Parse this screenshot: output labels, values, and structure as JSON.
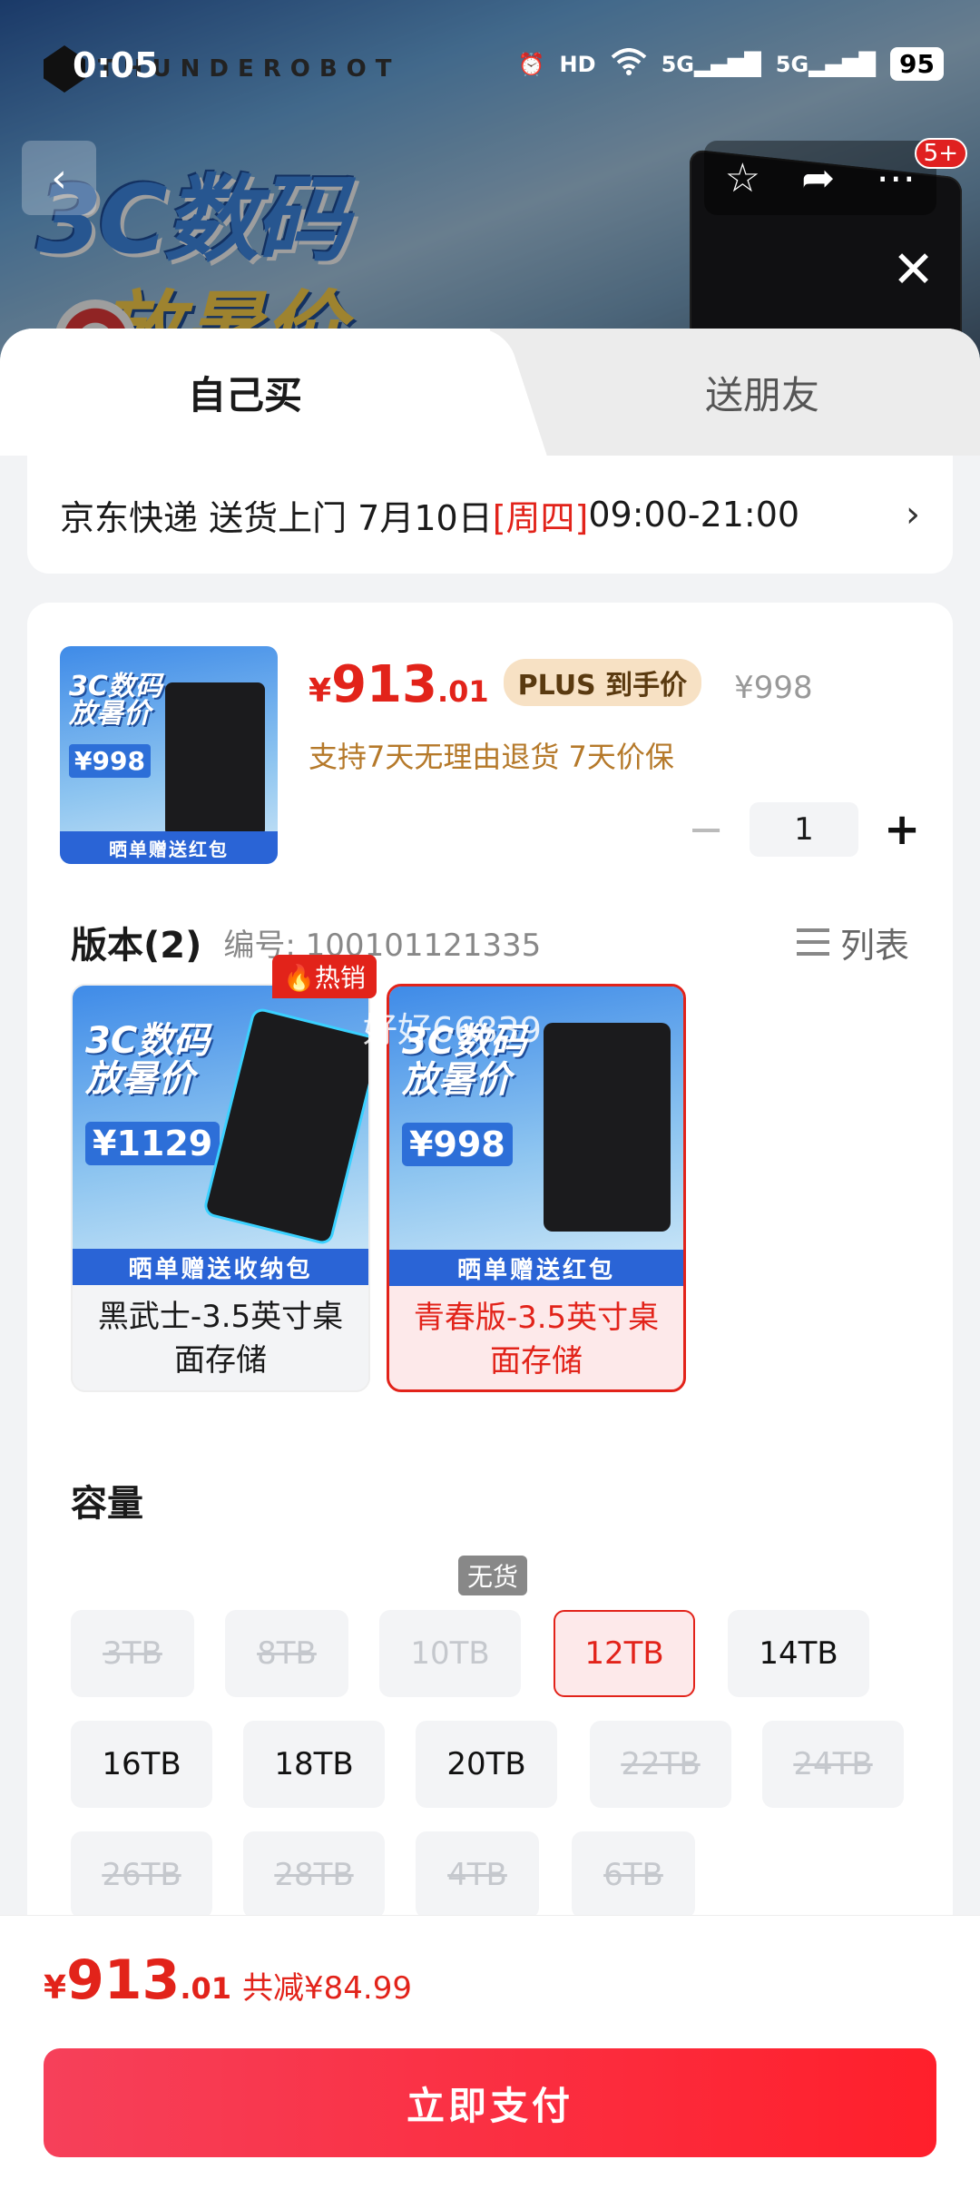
{
  "status_bar": {
    "time": "0:05",
    "brand": "THUNDEROBOT",
    "icons": [
      "alarm-icon",
      "hd-icon",
      "wifi-icon",
      "5g-signal-icon",
      "5g-signal-icon"
    ],
    "hd_label": "HD",
    "net1_label": "5G",
    "net2_label": "5G",
    "battery": "95"
  },
  "banner": {
    "title_line1": "3C数码",
    "title_line2": "放暑价",
    "notification_badge": "5+"
  },
  "tabs": {
    "self": "自己买",
    "friend": "送朋友"
  },
  "delivery": {
    "text": "京东快递 送货上门 7月10日 ",
    "weekday": "[周四]",
    "time": " 09:00-21:00",
    "chevron": "›"
  },
  "product": {
    "thumb_title": "3C数码放暑价",
    "thumb_price": "¥998",
    "thumb_banner": "晒单赠送红包",
    "price_currency": "¥",
    "price_int": "913",
    "price_dec": ".01",
    "plus_label": "PLUS 到手价",
    "original_price": "¥998",
    "guarantee": "支持7天无理由退货  7天价保",
    "quantity": "1"
  },
  "versions": {
    "title": "版本(2)",
    "code": "编号: 100101121335",
    "list_label": "列表",
    "hot_tag": "热销",
    "watermark": "好好66839",
    "items": [
      {
        "name": "黑武士-3.5英寸桌面存储",
        "img_title": "3C数码放暑价",
        "img_price": "¥1129",
        "img_banner": "晒单赠送收纳包",
        "selected": false
      },
      {
        "name": "青春版-3.5英寸桌面存储",
        "img_title": "3C数码放暑价",
        "img_price": "¥998",
        "img_banner": "晒单赠送红包",
        "selected": true
      }
    ]
  },
  "capacity": {
    "title": "容量",
    "no_stock_tag": "无货",
    "options": [
      {
        "label": "3TB",
        "state": "disabled"
      },
      {
        "label": "8TB",
        "state": "disabled"
      },
      {
        "label": "10TB",
        "state": "nostock"
      },
      {
        "label": "12TB",
        "state": "selected"
      },
      {
        "label": "14TB",
        "state": "normal"
      },
      {
        "label": "16TB",
        "state": "normal"
      },
      {
        "label": "18TB",
        "state": "normal"
      },
      {
        "label": "20TB",
        "state": "normal"
      },
      {
        "label": "22TB",
        "state": "disabled"
      },
      {
        "label": "24TB",
        "state": "disabled"
      },
      {
        "label": "26TB",
        "state": "disabled"
      },
      {
        "label": "28TB",
        "state": "disabled"
      },
      {
        "label": "4TB",
        "state": "disabled"
      },
      {
        "label": "6TB",
        "state": "disabled"
      }
    ]
  },
  "footer": {
    "currency": "¥",
    "total_int": "913",
    "total_dec": ".01",
    "saving": "共减¥84.99",
    "pay_label": "立即支付"
  },
  "colors": {
    "accent": "#e2231a",
    "plus_bg": "#f7e1c4",
    "guarantee": "#b5792a"
  }
}
